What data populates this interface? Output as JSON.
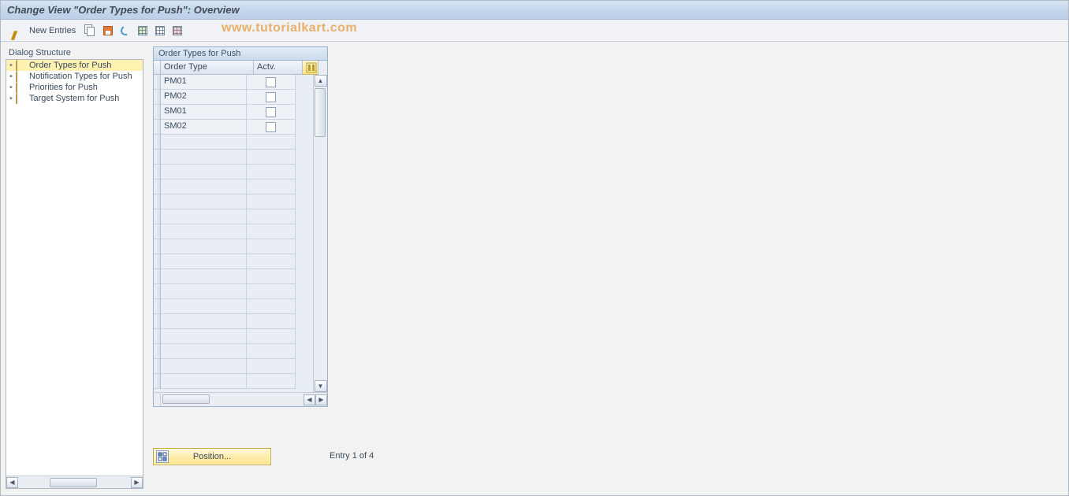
{
  "title": "Change View \"Order Types for Push\": Overview",
  "toolbar": {
    "new_entries_label": "New Entries"
  },
  "watermark": "www.tutorialkart.com",
  "dialog_structure": {
    "title": "Dialog Structure",
    "items": [
      {
        "label": "Order Types for Push",
        "selected": true,
        "open": true
      },
      {
        "label": "Notification Types for Push",
        "selected": false,
        "open": false
      },
      {
        "label": "Priorities for Push",
        "selected": false,
        "open": false
      },
      {
        "label": "Target System for Push",
        "selected": false,
        "open": false
      }
    ]
  },
  "table": {
    "title": "Order Types for Push",
    "columns": {
      "c1": "Order Type",
      "c2": "Actv."
    },
    "rows": [
      {
        "order_type": "PM01",
        "active": false
      },
      {
        "order_type": "PM02",
        "active": false
      },
      {
        "order_type": "SM01",
        "active": false
      },
      {
        "order_type": "SM02",
        "active": false
      }
    ],
    "empty_rows": 17
  },
  "footer": {
    "position_label": "Position...",
    "entry_text": "Entry 1 of 4"
  }
}
